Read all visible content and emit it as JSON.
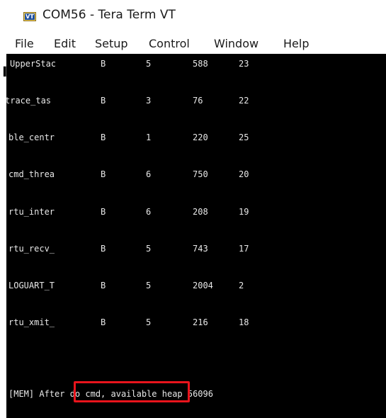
{
  "window": {
    "title": "COM56 - Tera Term VT",
    "icon_label": "VT"
  },
  "menu": [
    "File",
    "Edit",
    "Setup",
    "Control",
    "Window",
    "Help"
  ],
  "tasks": [
    {
      "name": "UpperStac",
      "state": "B",
      "priority": "5",
      "stack": "588",
      "num": "23"
    },
    {
      "name": "trace_tas",
      "state": "B",
      "priority": "3",
      "stack": "76",
      "num": "22"
    },
    {
      "name": "ble_centr",
      "state": "B",
      "priority": "1",
      "stack": "220",
      "num": "25"
    },
    {
      "name": "cmd_threa",
      "state": "B",
      "priority": "6",
      "stack": "750",
      "num": "20"
    },
    {
      "name": "rtu_inter",
      "state": "B",
      "priority": "6",
      "stack": "208",
      "num": "19"
    },
    {
      "name": "rtu_recv_",
      "state": "B",
      "priority": "5",
      "stack": "743",
      "num": "17"
    },
    {
      "name": "LOGUART_T",
      "state": "B",
      "priority": "5",
      "stack": "2004",
      "num": "2"
    },
    {
      "name": "rtu_xmit_",
      "state": "B",
      "priority": "5",
      "stack": "216",
      "num": "18"
    }
  ],
  "status_line": "[MEM] After do cmd, available heap 56096",
  "colors": {
    "terminal_bg": "#000000",
    "terminal_fg": "#e8e8e8",
    "highlight": "#e8141c"
  }
}
